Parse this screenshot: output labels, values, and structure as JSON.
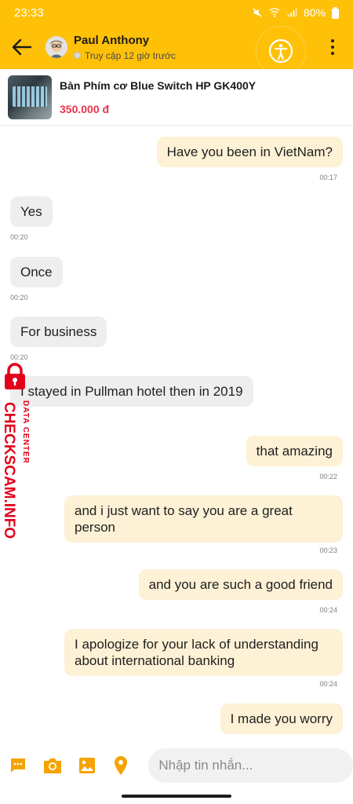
{
  "status_bar": {
    "time": "23:33",
    "battery": "80%"
  },
  "header": {
    "name": "Paul Anthony",
    "last_seen": "Truy cập 12 giờ trước"
  },
  "product": {
    "name": "Bàn Phím cơ Blue Switch HP GK400Y",
    "price": "350.000 đ"
  },
  "messages": [
    {
      "text": "Have you been in VietNam?",
      "time": "00:17"
    },
    {
      "text": "Yes",
      "time": "00:20"
    },
    {
      "text": "Once",
      "time": "00:20"
    },
    {
      "text": "For business",
      "time": "00:20"
    },
    {
      "text": "I stayed in Pullman hotel then in 2019",
      "time": ""
    },
    {
      "text": "that amazing",
      "time": "00:22"
    },
    {
      "text": "and i just want to say you are a great person",
      "time": "00:23"
    },
    {
      "text": "and you are such a good friend",
      "time": "00:24"
    },
    {
      "text": "I apologize for your lack of understanding about international banking",
      "time": "00:24"
    },
    {
      "text": "I made you worry",
      "time": ""
    }
  ],
  "watermark": {
    "brand": "CHECKSCAM.INFO",
    "tag": "DATA CENTER"
  },
  "composer": {
    "placeholder": "Nhập tin nhắn..."
  },
  "colors": {
    "accent": "#ffc107",
    "price": "#e8334a",
    "out_bubble": "#fdf1d6",
    "in_bubble": "#eeeeee",
    "watermark": "#e3001b"
  }
}
